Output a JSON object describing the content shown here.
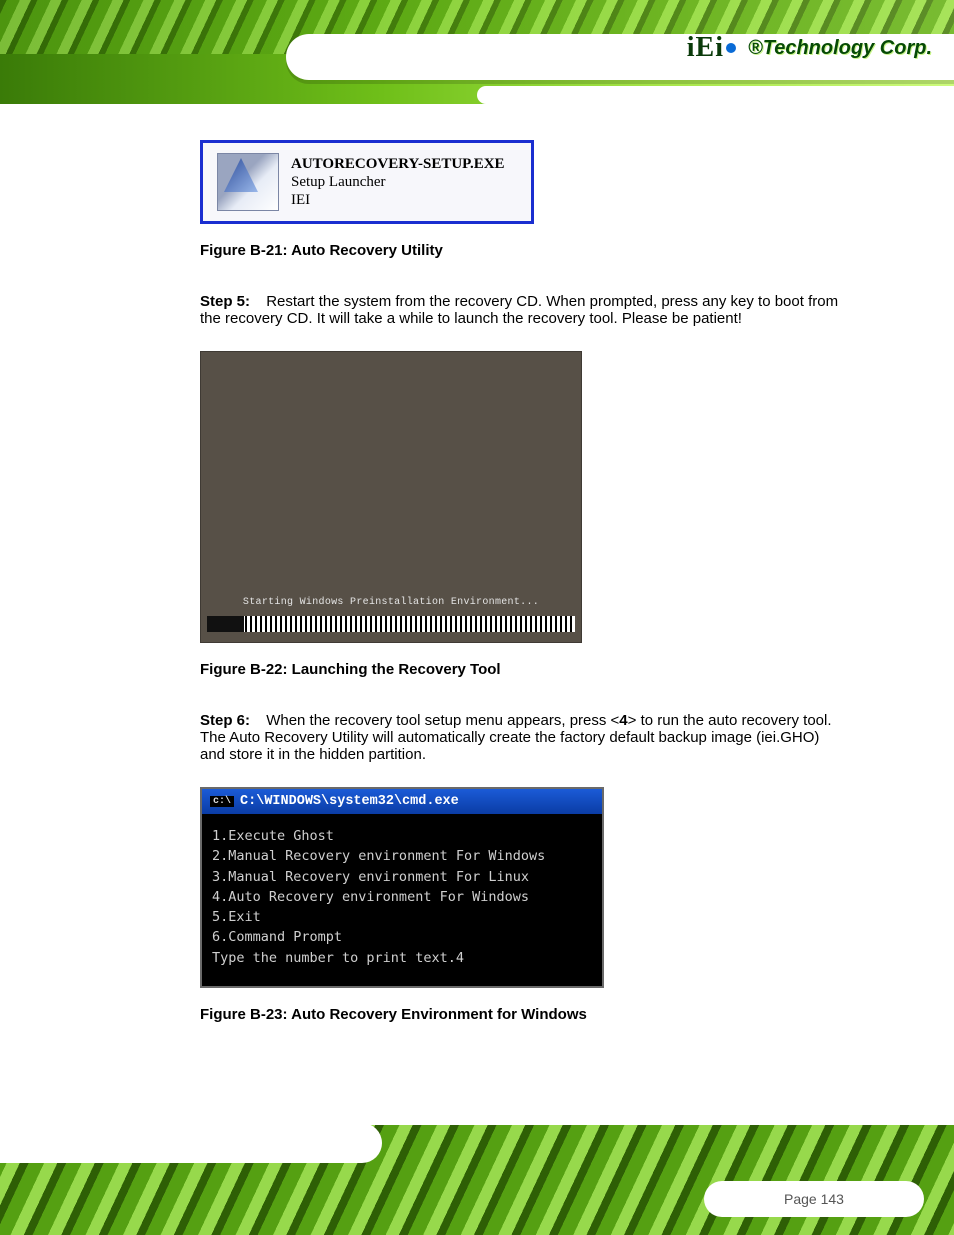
{
  "brand": {
    "logo_text": "iEi",
    "company": "®Technology Corp."
  },
  "figure1": {
    "title": "AUTORECOVERY-SETUP.EXE",
    "sub1": "Setup Launcher",
    "sub2": "IEI",
    "caption": "Figure B-21: Auto Recovery Utility"
  },
  "step5": {
    "label": "Step 5:",
    "text_before_b1": "Restart the system from the recovery CD. When prompted, press any key to boot from the recovery CD. It will take a while to launch the recovery tool. Please be patient!"
  },
  "figure2": {
    "screen_text": "Starting Windows Preinstallation Environment...",
    "caption": "Figure B-22: Launching the Recovery Tool"
  },
  "step6": {
    "label": "Step 6:",
    "text": "When the recovery tool setup menu appears, press <",
    "key": "4",
    "text_after": "> to run the auto recovery tool. The Auto Recovery Utility will automatically create the factory default backup image (iei.GHO) and store it in the hidden partition."
  },
  "figure3": {
    "cmd_title": "C:\\WINDOWS\\system32\\cmd.exe",
    "lines": [
      "1.Execute Ghost",
      "2.Manual Recovery environment For Windows",
      "3.Manual Recovery environment For Linux",
      "4.Auto Recovery environment For Windows",
      "5.Exit",
      "6.Command Prompt",
      "Type the number to print text.4"
    ],
    "caption": "Figure B-23: Auto Recovery Environment for Windows"
  },
  "page_number": "Page 143"
}
